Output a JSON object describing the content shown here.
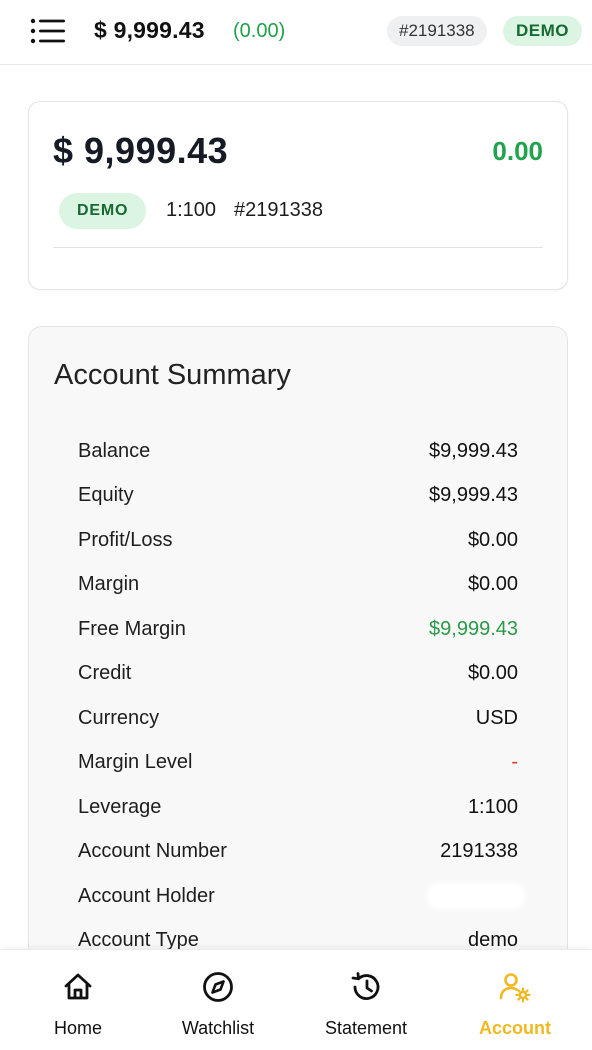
{
  "header": {
    "balance": "$ 9,999.43",
    "change": "(0.00)",
    "account_number": "#2191338",
    "mode_badge": "DEMO"
  },
  "balance_card": {
    "balance": "$ 9,999.43",
    "change": "0.00",
    "mode_badge": "DEMO",
    "leverage": "1:100",
    "account_number": "#2191338"
  },
  "summary": {
    "title": "Account Summary",
    "rows": [
      {
        "label": "Balance",
        "value": "$9,999.43"
      },
      {
        "label": "Equity",
        "value": "$9,999.43"
      },
      {
        "label": "Profit/Loss",
        "value": "$0.00"
      },
      {
        "label": "Margin",
        "value": "$0.00"
      },
      {
        "label": "Free Margin",
        "value": "$9,999.43"
      },
      {
        "label": "Credit",
        "value": "$0.00"
      },
      {
        "label": "Currency",
        "value": "USD"
      },
      {
        "label": "Margin Level",
        "value": "-"
      },
      {
        "label": "Leverage",
        "value": "1:100"
      },
      {
        "label": "Account Number",
        "value": "2191338"
      },
      {
        "label": "Account Holder",
        "value": ""
      },
      {
        "label": "Account Type",
        "value": "demo"
      }
    ]
  },
  "nav": {
    "items": [
      {
        "label": "Home",
        "icon": "home-icon"
      },
      {
        "label": "Watchlist",
        "icon": "compass-icon"
      },
      {
        "label": "Statement",
        "icon": "history-icon"
      },
      {
        "label": "Account",
        "icon": "user-settings-icon"
      }
    ],
    "active": "Account"
  },
  "colors": {
    "positive": "#21a24c",
    "negative": "#d33c2c",
    "active_nav": "#f2b821",
    "demo_badge_bg": "#dcf5e3",
    "demo_badge_text": "#176a33"
  }
}
